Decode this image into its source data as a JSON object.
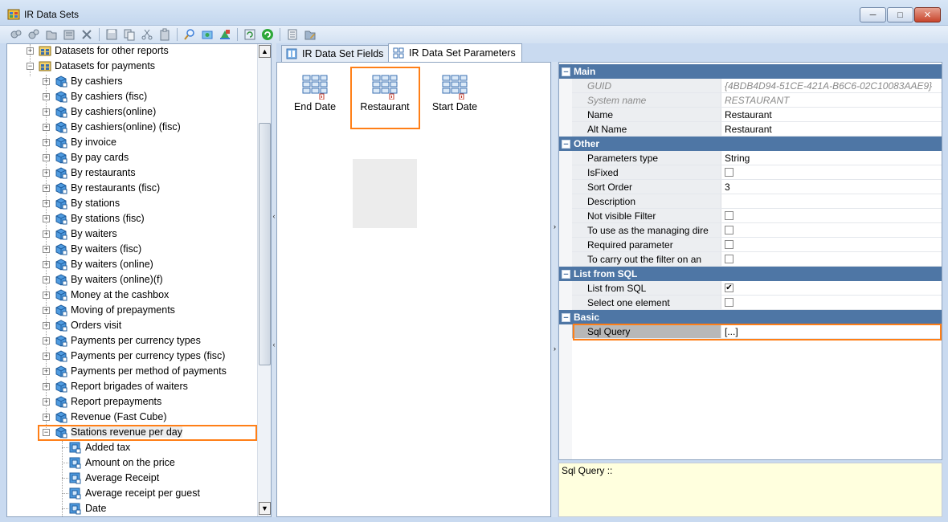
{
  "window": {
    "title": "IR Data Sets",
    "controls": {
      "minimize": "─",
      "maximize": "□",
      "close": "✕"
    }
  },
  "toolbar": {
    "icons": [
      "add-dataset-icon",
      "add-group-icon",
      "folder-icon",
      "properties-icon",
      "delete-icon",
      "save-icon",
      "copy-icon",
      "cut-icon",
      "paste-icon",
      "search-icon",
      "wizard-icon",
      "color-icon",
      "refresh-icon",
      "green-refresh-icon",
      "report-icon",
      "edit-icon"
    ]
  },
  "tree": {
    "items": [
      {
        "label": "Datasets for other reports",
        "level": 1,
        "expander": "+",
        "icon": "folder-grid-icon"
      },
      {
        "label": "Datasets for payments",
        "level": 1,
        "expander": "−",
        "icon": "folder-grid-icon"
      },
      {
        "label": "By cashiers",
        "level": 2,
        "expander": "+",
        "icon": "cube-icon"
      },
      {
        "label": "By cashiers (fisc)",
        "level": 2,
        "expander": "+",
        "icon": "cube-icon"
      },
      {
        "label": "By cashiers(online)",
        "level": 2,
        "expander": "+",
        "icon": "cube-icon"
      },
      {
        "label": "By cashiers(online) (fisc)",
        "level": 2,
        "expander": "+",
        "icon": "cube-icon"
      },
      {
        "label": "By invoice",
        "level": 2,
        "expander": "+",
        "icon": "cube-icon"
      },
      {
        "label": "By pay cards",
        "level": 2,
        "expander": "+",
        "icon": "cube-icon"
      },
      {
        "label": "By restaurants",
        "level": 2,
        "expander": "+",
        "icon": "cube-icon"
      },
      {
        "label": "By restaurants (fisc)",
        "level": 2,
        "expander": "+",
        "icon": "cube-icon"
      },
      {
        "label": "By stations",
        "level": 2,
        "expander": "+",
        "icon": "cube-icon"
      },
      {
        "label": "By stations (fisc)",
        "level": 2,
        "expander": "+",
        "icon": "cube-icon"
      },
      {
        "label": "By waiters",
        "level": 2,
        "expander": "+",
        "icon": "cube-icon"
      },
      {
        "label": "By waiters (fisc)",
        "level": 2,
        "expander": "+",
        "icon": "cube-icon"
      },
      {
        "label": "By waiters (online)",
        "level": 2,
        "expander": "+",
        "icon": "cube-icon"
      },
      {
        "label": "By waiters (online)(f)",
        "level": 2,
        "expander": "+",
        "icon": "cube-icon"
      },
      {
        "label": "Money at the cashbox",
        "level": 2,
        "expander": "+",
        "icon": "cube-icon"
      },
      {
        "label": "Moving of prepayments",
        "level": 2,
        "expander": "+",
        "icon": "cube-icon"
      },
      {
        "label": "Orders visit",
        "level": 2,
        "expander": "+",
        "icon": "cube-icon"
      },
      {
        "label": "Payments per currency types",
        "level": 2,
        "expander": "+",
        "icon": "cube-icon"
      },
      {
        "label": "Payments per currency types (fisc)",
        "level": 2,
        "expander": "+",
        "icon": "cube-icon"
      },
      {
        "label": "Payments per method of payments",
        "level": 2,
        "expander": "+",
        "icon": "cube-icon"
      },
      {
        "label": "Report brigades of waiters",
        "level": 2,
        "expander": "+",
        "icon": "cube-icon"
      },
      {
        "label": "Report prepayments",
        "level": 2,
        "expander": "+",
        "icon": "cube-icon"
      },
      {
        "label": "Revenue (Fast Cube)",
        "level": 2,
        "expander": "+",
        "icon": "cube-icon"
      },
      {
        "label": "Stations revenue per day",
        "level": 2,
        "expander": "−",
        "icon": "cube-icon",
        "selected": true
      },
      {
        "label": "Added tax",
        "level": 3,
        "expander": "",
        "icon": "field-icon"
      },
      {
        "label": "Amount on the price",
        "level": 3,
        "expander": "",
        "icon": "field-icon"
      },
      {
        "label": "Average Receipt",
        "level": 3,
        "expander": "",
        "icon": "field-icon"
      },
      {
        "label": "Average receipt per guest",
        "level": 3,
        "expander": "",
        "icon": "field-icon"
      },
      {
        "label": "Date",
        "level": 3,
        "expander": "",
        "icon": "field-icon"
      }
    ]
  },
  "tabs": [
    {
      "label": "IR Data Set Fields",
      "active": false
    },
    {
      "label": "IR Data Set Parameters",
      "active": true
    }
  ],
  "parameters": [
    {
      "label": "End Date",
      "selected": false
    },
    {
      "label": "Restaurant",
      "selected": true
    },
    {
      "label": "Start Date",
      "selected": false
    }
  ],
  "properties": {
    "categories": [
      {
        "name": "Main",
        "rows": [
          {
            "name": "GUID",
            "value": "{4BDB4D94-51CE-421A-B6C6-02C10083AAE9}",
            "readonly": true
          },
          {
            "name": "System name",
            "value": "RESTAURANT",
            "readonly": true
          },
          {
            "name": "Name",
            "value": "Restaurant"
          },
          {
            "name": "Alt Name",
            "value": "Restaurant"
          }
        ]
      },
      {
        "name": "Other",
        "rows": [
          {
            "name": "Parameters type",
            "value": "String"
          },
          {
            "name": "IsFixed",
            "checkbox": false
          },
          {
            "name": "Sort Order",
            "value": "3"
          },
          {
            "name": "Description",
            "value": ""
          },
          {
            "name": "Not visible Filter",
            "checkbox": false
          },
          {
            "name": "To use as the managing dire",
            "checkbox": false
          },
          {
            "name": "Required parameter",
            "checkbox": false
          },
          {
            "name": "To carry out the filter on an",
            "checkbox": false
          }
        ]
      },
      {
        "name": "List from SQL",
        "rows": [
          {
            "name": "List from SQL",
            "checkbox": true
          },
          {
            "name": "Select one element",
            "checkbox": false
          }
        ]
      },
      {
        "name": "Basic",
        "rows": [
          {
            "name": "Sql Query",
            "value": "[...]",
            "highlight": true
          }
        ]
      }
    ]
  },
  "description": {
    "text": "Sql Query ::"
  }
}
